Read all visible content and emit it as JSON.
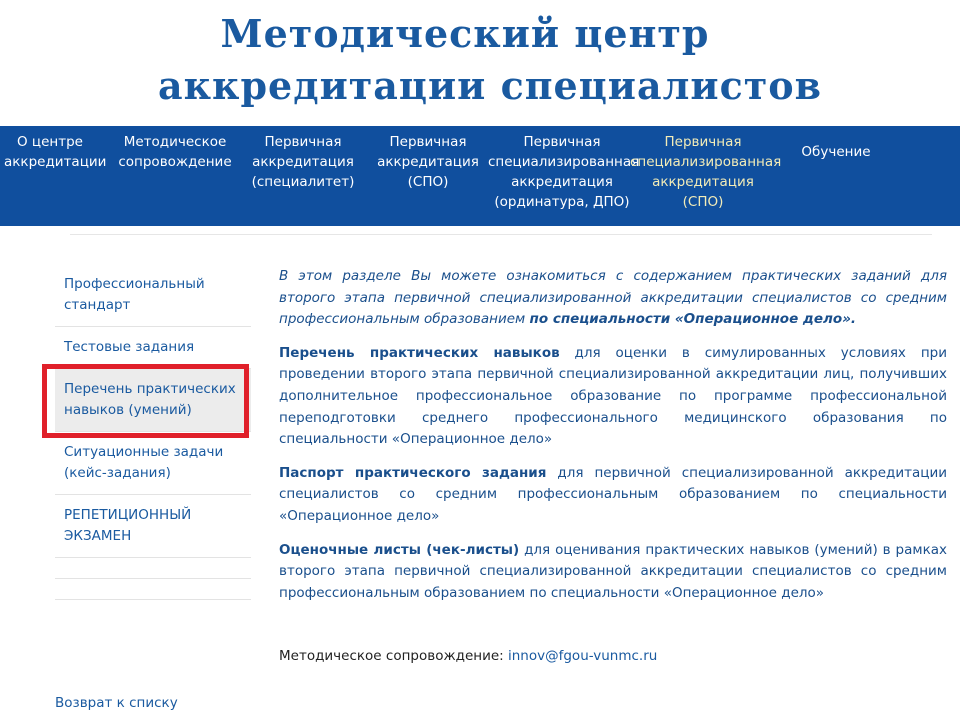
{
  "title": {
    "line1": "Методический центр",
    "line2": "аккредитации специалистов"
  },
  "nav": {
    "items": [
      {
        "label": "О центре\nаккредитации"
      },
      {
        "label": "Методическое\nсопровождение"
      },
      {
        "label": "Первичная\nаккредитация\n(специалитет)"
      },
      {
        "label": "Первичная\nаккредитация\n(СПО)"
      },
      {
        "label": "Первичная\nспециализированная\nаккредитация\n(ординатура, ДПО)"
      },
      {
        "label": "Первичная\nспециализированная\nаккредитация (СПО)",
        "active": true
      },
      {
        "label": "Обучение"
      }
    ]
  },
  "sidebar": {
    "items": [
      {
        "label": "Профессиональный\nстандарт"
      },
      {
        "label": "Тестовые задания"
      },
      {
        "label": "Перечень практических\nнавыков (умений)",
        "active": true
      },
      {
        "label": "Ситуационные задачи\n(кейс-задания)"
      },
      {
        "label": "РЕПЕТИЦИОННЫЙ\nЭКЗАМЕН"
      }
    ]
  },
  "content": {
    "intro": "В этом разделе Вы можете ознакомиться с содержанием практических заданий для второго этапа первичной специализированной аккредитации специалистов со средним профессиональным образованием ",
    "intro_bold": "по специальности «Операционное дело».",
    "p1_link": "Перечень практических навыков",
    "p1_rest": " для оценки в симулированных условиях при проведении второго этапа первичной специализированной аккредитации лиц, получивших дополнительное профессиональное образование по программе профессиональной переподготовки среднего профессионального медицинского образования по специальности «Операционное дело»",
    "p2_link": "Паспорт практического задания",
    "p2_rest": " для первичной специализированной аккредитации специалистов со средним профессиональным образованием по специальности «Операционное дело»",
    "p3_link": "Оценочные листы (чек-листы)",
    "p3_rest": " для оценивания практических навыков (умений) в рамках второго этапа первичной специализированной аккредитации специалистов со средним профессиональным образованием по специальности «Операционное дело»"
  },
  "contact": {
    "label": "Методическое сопровождение: ",
    "email": "innov@fgou-vunmc.ru"
  },
  "back_link": "Возврат к списку",
  "colors": {
    "nav_background": "#104f9e",
    "title": "#1a5aa0",
    "active_nav": "#f2ecb8",
    "highlight_frame": "#e0202a"
  }
}
